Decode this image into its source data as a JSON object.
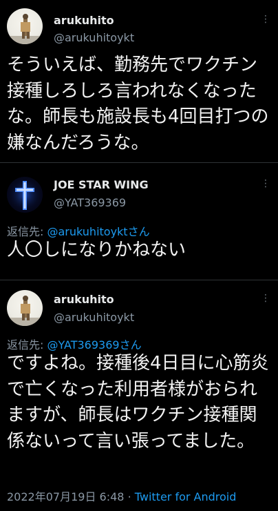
{
  "tweets": [
    {
      "name": "arukuhito",
      "handle": "@arukuhitoykt",
      "avatar_icon": "user-photo-avatar",
      "text": "そういえば、勤務先でワクチン接種しろしろ言われなくなったな。師長も施設長も4回目打つの嫌なんだろうな。"
    },
    {
      "name": "JOE STAR WING",
      "handle": "@YAT369369",
      "avatar_icon": "cross-avatar",
      "reply_prefix": "返信先: ",
      "reply_mention": "@arukuhitoykt",
      "reply_suffix": "さん",
      "text": "人〇しになりかねない"
    },
    {
      "name": "arukuhito",
      "handle": "@arukuhitoykt",
      "avatar_icon": "user-photo-avatar",
      "reply_prefix": "返信先: ",
      "reply_mention": "@YAT369369",
      "reply_suffix": "さん",
      "text": "ですよね。接種後4日目に心筋炎で亡くなった利用者様がおられますが、師長はワクチン接種関係ないって言い張ってました。",
      "timestamp": "2022年07月19日 6:48",
      "separator": "·",
      "client": "Twitter for Android"
    }
  ],
  "more_icon_glyph": "⋮",
  "colors": {
    "background": "#000000",
    "text": "#e7e9ea",
    "secondary": "#8b98a5",
    "link": "#1d9bf0",
    "divider": "#2f3336"
  }
}
